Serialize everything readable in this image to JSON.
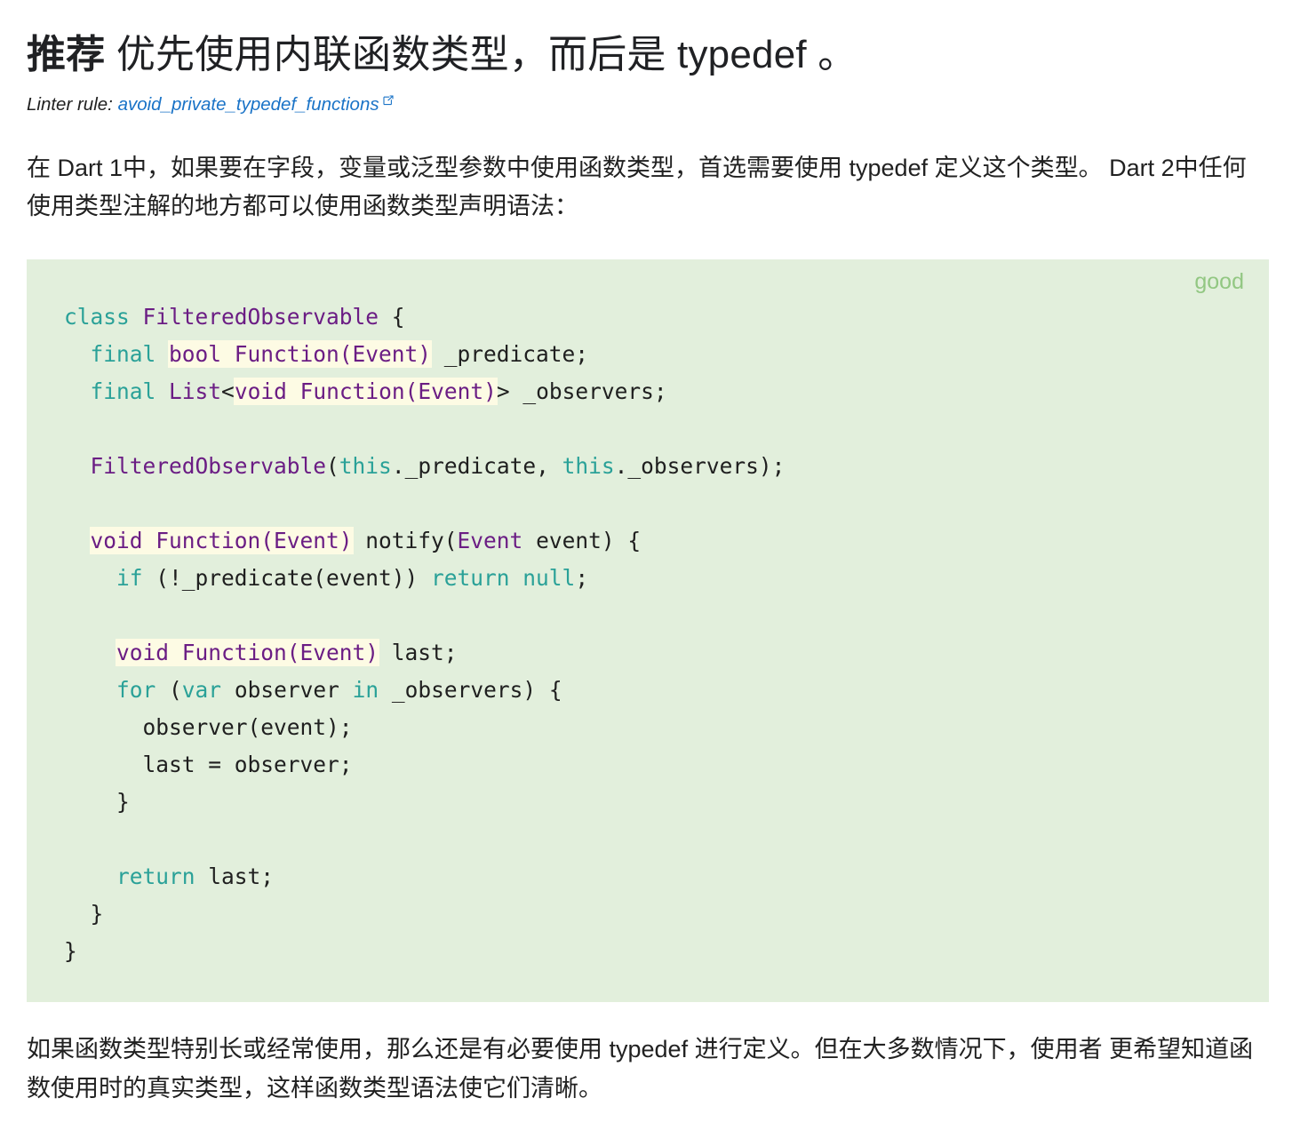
{
  "heading": {
    "keyword": "推荐",
    "rest": " 优先使用内联函数类型，而后是 typedef 。"
  },
  "linter": {
    "label": "Linter rule: ",
    "rule": "avoid_private_typedef_functions",
    "icon": "external-link-icon"
  },
  "paragraphs": {
    "intro": "在 Dart 1中，如果要在字段，变量或泛型参数中使用函数类型，首选需要使用 typedef 定义这个类型。 Dart 2中任何使用类型注解的地方都可以使用函数类型声明语法：",
    "outro": "如果函数类型特别长或经常使用，那么还是有必要使用 typedef 进行定义。但在大多数情况下，使用者 更希望知道函数使用时的真实类型，这样函数类型语法使它们清晰。"
  },
  "code_block": {
    "tag": "good",
    "language": "dart",
    "background": "#e2efdc",
    "tag_color": "#92c782",
    "highlight_color": "#fdfbe4",
    "keyword_color": "#2aa198",
    "type_color": "#6b1d84",
    "plain_color": "#1f1f1f",
    "lines": [
      [
        {
          "t": "class ",
          "c": "kw"
        },
        {
          "t": "FilteredObservable",
          "c": "type"
        },
        {
          "t": " {",
          "c": "pl"
        }
      ],
      [
        {
          "t": "  ",
          "c": "pl"
        },
        {
          "t": "final ",
          "c": "kw"
        },
        {
          "t": "bool Function(Event)",
          "c": "type",
          "hl": true
        },
        {
          "t": " _predicate;",
          "c": "pl"
        }
      ],
      [
        {
          "t": "  ",
          "c": "pl"
        },
        {
          "t": "final ",
          "c": "kw"
        },
        {
          "t": "List",
          "c": "type"
        },
        {
          "t": "<",
          "c": "pl"
        },
        {
          "t": "void Function(Event)",
          "c": "type",
          "hl": true
        },
        {
          "t": "> _observers;",
          "c": "pl"
        }
      ],
      [],
      [
        {
          "t": "  ",
          "c": "pl"
        },
        {
          "t": "FilteredObservable",
          "c": "type"
        },
        {
          "t": "(",
          "c": "pl"
        },
        {
          "t": "this",
          "c": "kw"
        },
        {
          "t": "._predicate, ",
          "c": "pl"
        },
        {
          "t": "this",
          "c": "kw"
        },
        {
          "t": "._observers);",
          "c": "pl"
        }
      ],
      [],
      [
        {
          "t": "  ",
          "c": "pl"
        },
        {
          "t": "void Function(Event)",
          "c": "type",
          "hl": true
        },
        {
          "t": " notify(",
          "c": "pl"
        },
        {
          "t": "Event",
          "c": "type"
        },
        {
          "t": " event) {",
          "c": "pl"
        }
      ],
      [
        {
          "t": "    ",
          "c": "pl"
        },
        {
          "t": "if",
          "c": "kw"
        },
        {
          "t": " (!_predicate(event)) ",
          "c": "pl"
        },
        {
          "t": "return null",
          "c": "kw"
        },
        {
          "t": ";",
          "c": "pl"
        }
      ],
      [],
      [
        {
          "t": "    ",
          "c": "pl"
        },
        {
          "t": "void Function(Event)",
          "c": "type",
          "hl": true
        },
        {
          "t": " last;",
          "c": "pl"
        }
      ],
      [
        {
          "t": "    ",
          "c": "pl"
        },
        {
          "t": "for",
          "c": "kw"
        },
        {
          "t": " (",
          "c": "pl"
        },
        {
          "t": "var",
          "c": "kw"
        },
        {
          "t": " observer ",
          "c": "pl"
        },
        {
          "t": "in",
          "c": "kw"
        },
        {
          "t": " _observers) {",
          "c": "pl"
        }
      ],
      [
        {
          "t": "      observer(event);",
          "c": "pl"
        }
      ],
      [
        {
          "t": "      last = observer;",
          "c": "pl"
        }
      ],
      [
        {
          "t": "    }",
          "c": "pl"
        }
      ],
      [],
      [
        {
          "t": "    ",
          "c": "pl"
        },
        {
          "t": "return",
          "c": "kw"
        },
        {
          "t": " last;",
          "c": "pl"
        }
      ],
      [
        {
          "t": "  }",
          "c": "pl"
        }
      ],
      [
        {
          "t": "}",
          "c": "pl"
        }
      ]
    ]
  }
}
